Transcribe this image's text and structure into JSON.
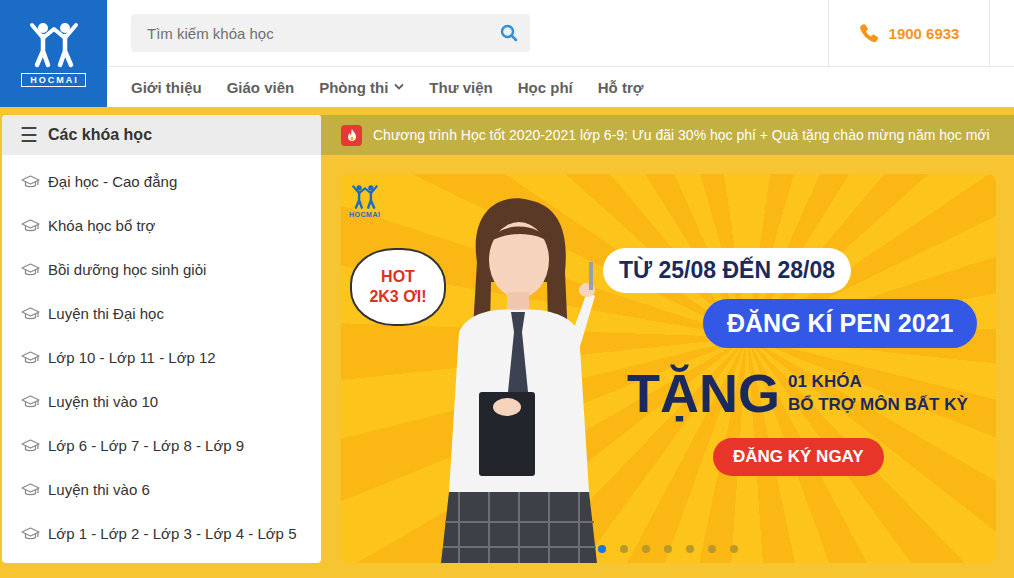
{
  "logo": {
    "text": "HOCMAI"
  },
  "search": {
    "placeholder": "Tìm kiếm khóa học"
  },
  "hotline": "1900 6933",
  "nav": [
    {
      "label": "Giới thiệu",
      "has_dropdown": false
    },
    {
      "label": "Giáo viên",
      "has_dropdown": false
    },
    {
      "label": "Phòng thi",
      "has_dropdown": true
    },
    {
      "label": "Thư viện",
      "has_dropdown": false
    },
    {
      "label": "Học phí",
      "has_dropdown": false
    },
    {
      "label": "Hỗ trợ",
      "has_dropdown": false
    }
  ],
  "sidebar": {
    "menu_icon": "☰",
    "title": "Các khóa học",
    "items": [
      "Đại học - Cao đẳng",
      "Khóa học bổ trợ",
      "Bồi dưỡng học sinh giỏi",
      "Luyện thi Đại học",
      "Lớp 10 - Lớp 11 - Lớp 12",
      "Luyện thi vào 10",
      "Lớp 6 - Lớp 7 - Lớp 8 - Lớp 9",
      "Luyện thi vào 6",
      "Lớp 1 - Lớp 2 - Lớp 3 - Lớp 4 - Lớp 5"
    ]
  },
  "announcement": "Chương trình Học tốt 2020-2021 lớp 6-9: Ưu đãi 30% học phí + Quà tặng chào mừng năm học mới",
  "banner": {
    "logo_text": "HOCMAI",
    "bubble": [
      "HOT",
      "2K3 ƠI!"
    ],
    "date": "TỪ 25/08 ĐẾN 28/08",
    "headline": "ĐĂNG KÍ PEN 2021",
    "gift": "TẶNG",
    "gift_lines": [
      "01 KHÓA",
      "BỔ TRỢ MÔN BẤT KỲ"
    ],
    "cta": "ĐĂNG KÝ NGAY",
    "dots": [
      {
        "selected": true
      },
      {
        "selected": false
      },
      {
        "selected": false
      },
      {
        "selected": false
      },
      {
        "selected": false
      },
      {
        "selected": false
      },
      {
        "selected": false
      }
    ]
  }
}
